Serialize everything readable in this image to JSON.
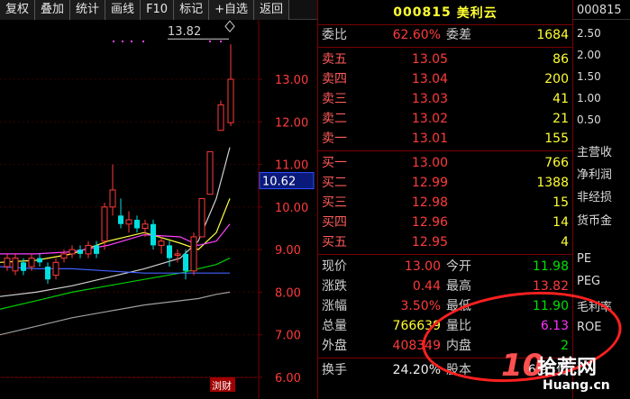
{
  "toolbar": {
    "items": [
      "复权",
      "叠加",
      "统计",
      "画线",
      "F10",
      "标记",
      "+自选",
      "返回"
    ]
  },
  "chart": {
    "price_ticks": [
      "13.00",
      "12.00",
      "11.00",
      "10.00",
      "9.00",
      "8.00",
      "7.00",
      "6.00"
    ],
    "high_marker": "13.82",
    "current_price_tag": "10.62",
    "logo_text": "浏财"
  },
  "quote": {
    "code": "000815",
    "name": "美利云",
    "ratio_label": "委比",
    "ratio_value": "62.60%",
    "diff_label": "委差",
    "diff_value": "1684",
    "sell": [
      {
        "label": "卖五",
        "price": "13.05",
        "vol": "86"
      },
      {
        "label": "卖四",
        "price": "13.04",
        "vol": "200"
      },
      {
        "label": "卖三",
        "price": "13.03",
        "vol": "41"
      },
      {
        "label": "卖二",
        "price": "13.02",
        "vol": "21"
      },
      {
        "label": "卖一",
        "price": "13.01",
        "vol": "155"
      }
    ],
    "buy": [
      {
        "label": "买一",
        "price": "13.00",
        "vol": "766"
      },
      {
        "label": "买二",
        "price": "12.99",
        "vol": "1388"
      },
      {
        "label": "买三",
        "price": "12.98",
        "vol": "15"
      },
      {
        "label": "买四",
        "price": "12.96",
        "vol": "14"
      },
      {
        "label": "买五",
        "price": "12.95",
        "vol": "4"
      }
    ],
    "stats": [
      {
        "l1": "现价",
        "v1": "13.00",
        "l2": "今开",
        "v2": "11.98"
      },
      {
        "l1": "涨跌",
        "v1": "0.44",
        "l2": "最高",
        "v2": "13.82"
      },
      {
        "l1": "涨幅",
        "v1": "3.50%",
        "l2": "最低",
        "v2": "11.90"
      },
      {
        "l1": "总量",
        "v1": "766639",
        "l2": "量比",
        "v2": "6.13"
      },
      {
        "l1": "外盘",
        "v1": "408349",
        "l2": "内盘",
        "v2": "2"
      }
    ],
    "last_row": {
      "l1": "换手",
      "v1": "24.20%",
      "l2": "股本",
      "v2": "6.95亿"
    }
  },
  "side": {
    "code": "000815",
    "ticks": [
      "2.50",
      "2.00",
      "1.50",
      "1.00",
      "0.50"
    ],
    "items": [
      "主营收",
      "净利润",
      "非经损",
      "货币金",
      "PE",
      "PEG",
      "毛利率",
      "ROE"
    ]
  },
  "watermark": {
    "big": "10",
    "cn": "拾荒网",
    "url": "Huang.cn"
  },
  "colors": {
    "up": "#ff3b3b",
    "down": "#00e000",
    "vol": "#ffff33",
    "frame": "#7a0000"
  }
}
